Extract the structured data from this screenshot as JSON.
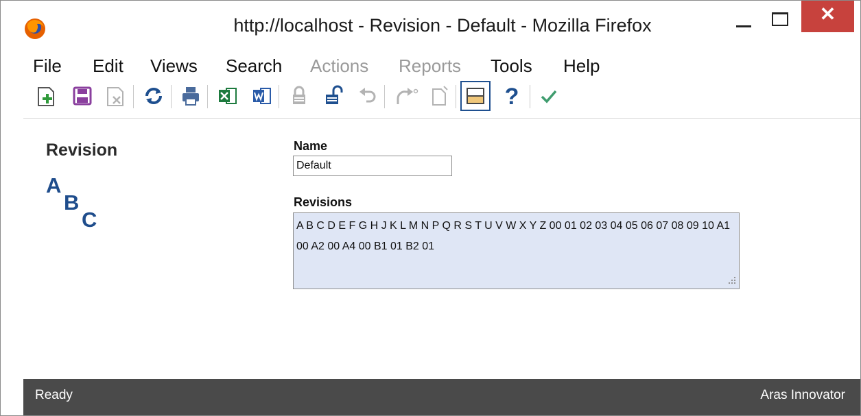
{
  "window": {
    "title": "http://localhost - Revision - Default - Mozilla Firefox",
    "close_glyph": "✕"
  },
  "menubar": {
    "items": [
      {
        "label": "File",
        "enabled": true
      },
      {
        "label": "Edit",
        "enabled": true
      },
      {
        "label": "Views",
        "enabled": true
      },
      {
        "label": "Search",
        "enabled": true
      },
      {
        "label": "Actions",
        "enabled": false
      },
      {
        "label": "Reports",
        "enabled": false
      },
      {
        "label": "Tools",
        "enabled": true
      },
      {
        "label": "Help",
        "enabled": true
      }
    ]
  },
  "toolbar": {
    "icons": [
      "new-item-icon",
      "save-icon",
      "discard-icon",
      "refresh-icon",
      "print-icon",
      "export-excel-icon",
      "export-word-icon",
      "lock-icon",
      "unlock-icon",
      "undo-icon",
      "promote-icon",
      "version-icon",
      "toggle-pane-icon",
      "help-icon",
      "done-icon"
    ],
    "help_glyph": "?"
  },
  "form": {
    "itemtype_title": "Revision",
    "logo_letters": [
      "A",
      "B",
      "C"
    ],
    "name_label": "Name",
    "name_value": "Default",
    "revisions_label": "Revisions",
    "revisions_value": "A B C D E F G H J K L M N P Q R S T U V W X Y Z 00 01 02 03 04 05 06 07 08 09 10 A1 00 A2 00 A4 00 B1 01 B2 01"
  },
  "statusbar": {
    "status": "Ready",
    "product": "Aras Innovator"
  },
  "colors": {
    "close_button": "#c7423d",
    "statusbar": "#4a4a4a",
    "textarea_bg": "#dfe6f5",
    "logo_blue": "#1f4d8c",
    "check_green": "#3f9c6e"
  }
}
